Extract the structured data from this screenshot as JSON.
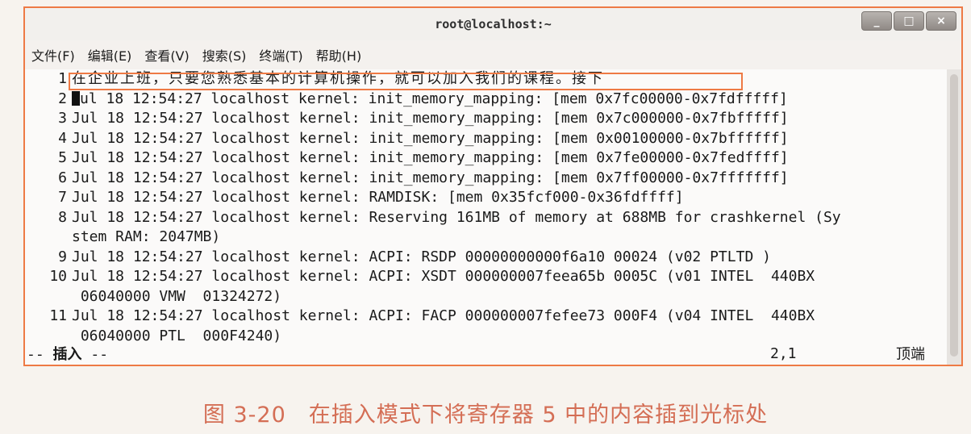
{
  "window": {
    "title": "root@localhost:~",
    "buttons": {
      "minimize": "_",
      "maximize": "□",
      "close": "×"
    }
  },
  "menu": [
    "文件(F)",
    "编辑(E)",
    "查看(V)",
    "搜索(S)",
    "终端(T)",
    "帮助(H)"
  ],
  "terminal": {
    "lines": [
      {
        "num": "1",
        "text": "在企业上班，只要您熟悉基本的计算机操作，就可以加入我们的课程。接下"
      },
      {
        "num": "2",
        "text": "ul 18 12:54:27 localhost kernel: init_memory_mapping: [mem 0x7fc00000-0x7fdfffff]"
      },
      {
        "num": "3",
        "text": "Jul 18 12:54:27 localhost kernel: init_memory_mapping: [mem 0x7c000000-0x7fbfffff]"
      },
      {
        "num": "4",
        "text": "Jul 18 12:54:27 localhost kernel: init_memory_mapping: [mem 0x00100000-0x7bffffff]"
      },
      {
        "num": "5",
        "text": "Jul 18 12:54:27 localhost kernel: init_memory_mapping: [mem 0x7fe00000-0x7fedffff]"
      },
      {
        "num": "6",
        "text": "Jul 18 12:54:27 localhost kernel: init_memory_mapping: [mem 0x7ff00000-0x7fffffff]"
      },
      {
        "num": "7",
        "text": "Jul 18 12:54:27 localhost kernel: RAMDISK: [mem 0x35fcf000-0x36fdffff]"
      },
      {
        "num": "8",
        "text": "Jul 18 12:54:27 localhost kernel: Reserving 161MB of memory at 688MB for crashkernel (Sy",
        "cont": "stem RAM: 2047MB)"
      },
      {
        "num": "9",
        "text": "Jul 18 12:54:27 localhost kernel: ACPI: RSDP 00000000000f6a10 00024 (v02 PTLTD )"
      },
      {
        "num": "10",
        "text": "Jul 18 12:54:27 localhost kernel: ACPI: XSDT 000000007feea65b 0005C (v01 INTEL  440BX",
        "cont": " 06040000 VMW  01324272)"
      },
      {
        "num": "11",
        "text": "Jul 18 12:54:27 localhost kernel: ACPI: FACP 000000007fefee73 000F4 (v04 INTEL  440BX",
        "cont": " 06040000 PTL  000F4240)"
      }
    ],
    "status": {
      "mode_prefix": "--",
      "mode": "插入",
      "mode_suffix": "--",
      "position": "2,1",
      "scroll": "顶端"
    }
  },
  "caption": "图 3-20　在插入模式下将寄存器 5 中的内容插到光标处"
}
